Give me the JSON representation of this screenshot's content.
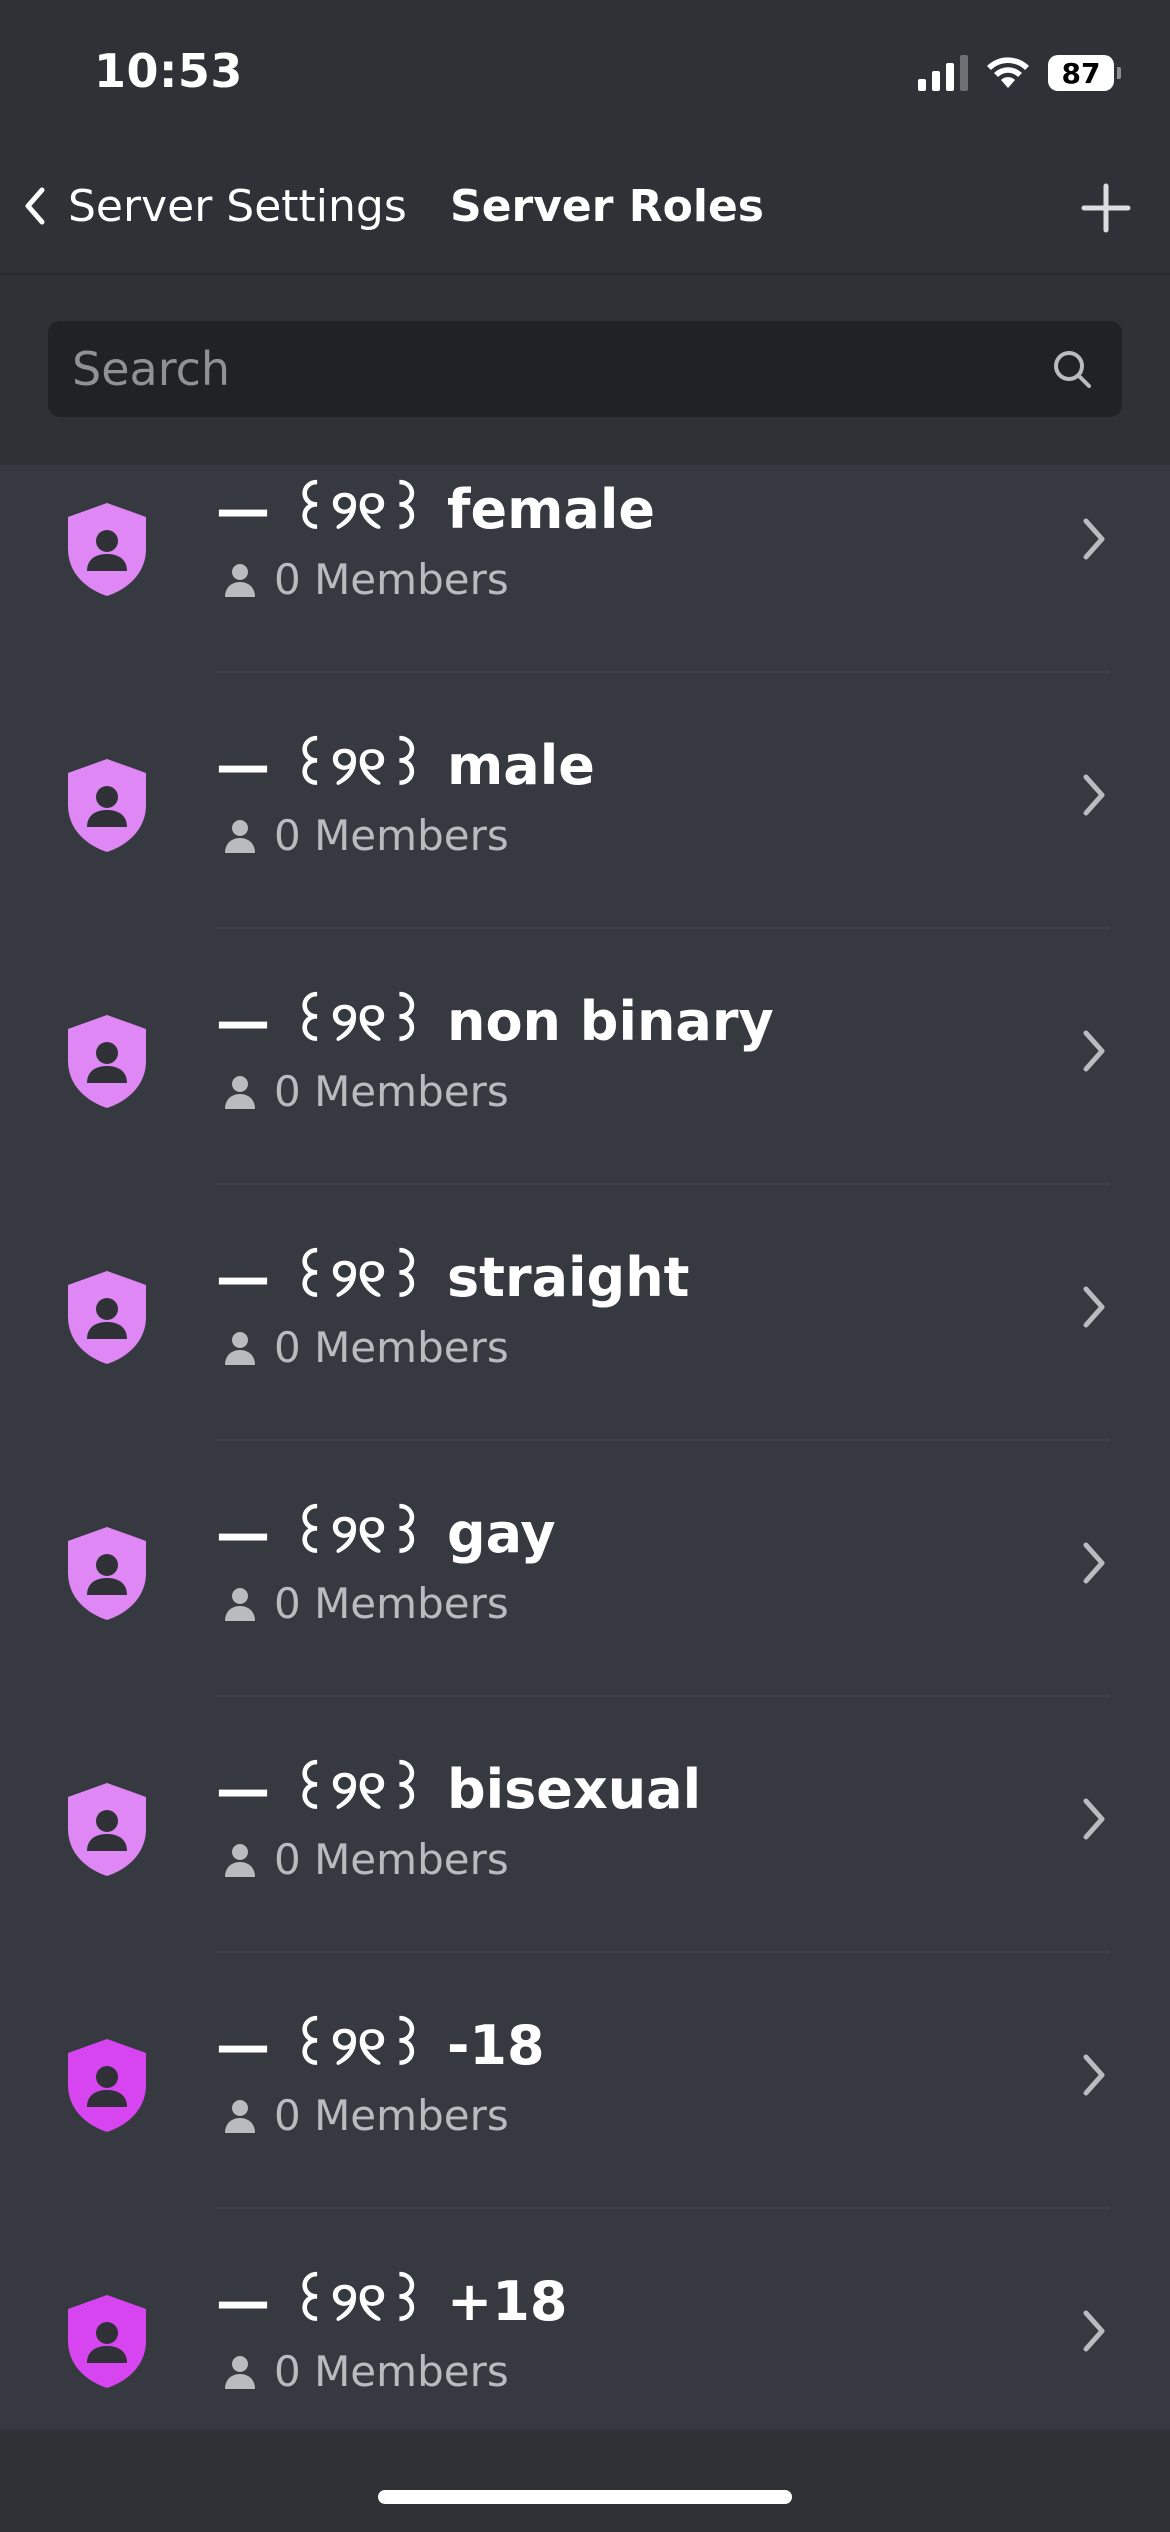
{
  "status_bar": {
    "time": "10:53",
    "battery": "87"
  },
  "nav": {
    "back_label": "Server Settings",
    "title": "Server Roles"
  },
  "search": {
    "placeholder": "Search"
  },
  "roles": [
    {
      "name": "— ꒰୨୧꒱ female",
      "members": "0 Members",
      "color": "#df88f5"
    },
    {
      "name": "— ꒰୨୧꒱ male",
      "members": "0 Members",
      "color": "#df88f5"
    },
    {
      "name": "— ꒰୨୧꒱ non binary",
      "members": "0 Members",
      "color": "#df88f5"
    },
    {
      "name": "— ꒰୨୧꒱ straight",
      "members": "0 Members",
      "color": "#df88f5"
    },
    {
      "name": "— ꒰୨୧꒱ gay",
      "members": "0 Members",
      "color": "#df88f5"
    },
    {
      "name": "— ꒰୨୧꒱ bisexual",
      "members": "0 Members",
      "color": "#df88f5"
    },
    {
      "name": "— ꒰୨୧꒱ -18",
      "members": "0 Members",
      "color": "#d645f0"
    },
    {
      "name": "— ꒰୨୧꒱ +18",
      "members": "0 Members",
      "color": "#d645f0"
    }
  ],
  "icons": {
    "back": "chevron-left-icon",
    "add": "plus-icon",
    "search": "search-icon",
    "role": "shield-user-icon",
    "members": "person-icon",
    "row_nav": "chevron-right-icon"
  },
  "colors": {
    "background": "#36393f",
    "header": "#2f3136",
    "search_field": "#202225",
    "secondary_text": "#b9bbbe"
  }
}
